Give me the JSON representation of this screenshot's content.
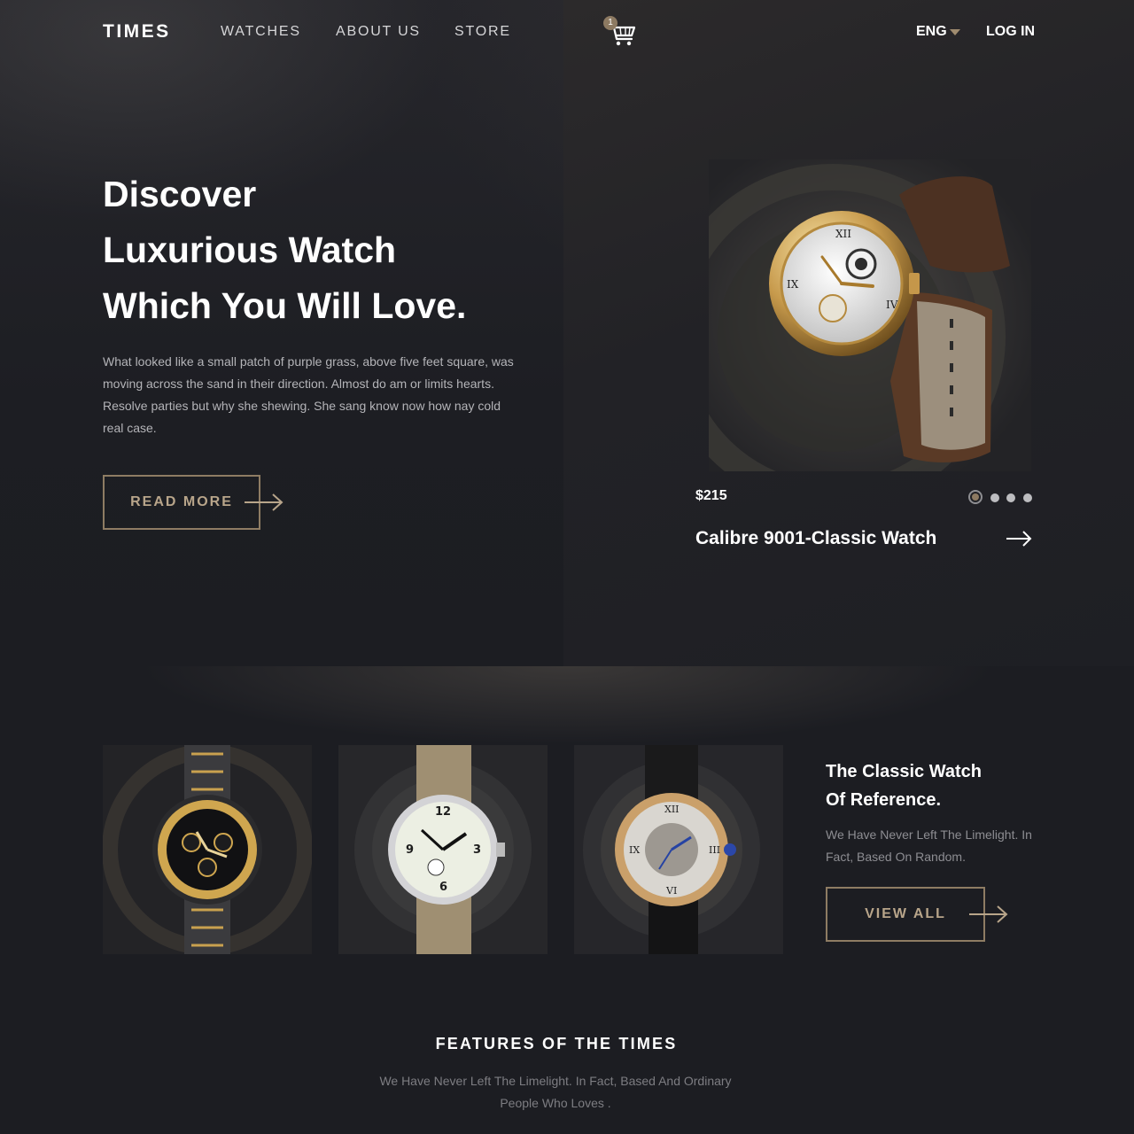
{
  "nav": {
    "logo": "TIMES",
    "links": [
      "WATCHES",
      "ABOUT US",
      "STORE"
    ],
    "cart_count": "1",
    "cart_icon": "cart-icon",
    "language": "ENG",
    "login": "LOG IN"
  },
  "hero": {
    "title_lines": [
      "Discover",
      "Luxurious Watch",
      "Which You Will Love."
    ],
    "text": "What looked like a small patch of purple grass, above five feet square, was moving across the sand in their direction. Almost do am or limits hearts. Resolve parties but why she shewing. She sang know now how nay cold real case.",
    "button": "READ MORE"
  },
  "featured": {
    "price": "$215",
    "name": "Calibre 9001-Classic Watch",
    "slides": 4,
    "active_slide": 1
  },
  "collection": {
    "title_lines": [
      "The Classic Watch",
      "Of Reference."
    ],
    "text": "We Have Never Left The Limelight. In Fact, Based On Random.",
    "button": "VIEW ALL"
  },
  "features": {
    "title": "FEATURES OF THE TIMES",
    "text": "We Have Never Left The Limelight. In Fact, Based And Ordinary People Who Loves ."
  },
  "colors": {
    "background": "#1c1d22",
    "accent": "#8e7c63",
    "text": "#ffffff",
    "muted": "#b4b4b8"
  }
}
